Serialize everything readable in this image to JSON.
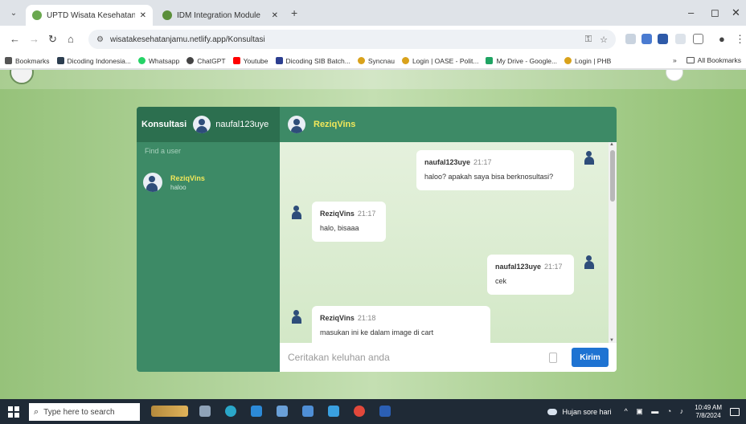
{
  "browser": {
    "tabs": [
      {
        "title": "UPTD Wisata Kesehatan Jamu",
        "active": true,
        "icon": "leaf-favicon-icon"
      },
      {
        "title": "IDM Integration Module",
        "active": false,
        "icon": "leaf-favicon-icon"
      }
    ],
    "url": "wisatakesehatanjamu.netlify.app/Konsultasi",
    "bookmarks": [
      {
        "label": "Bookmarks",
        "color": "#555555"
      },
      {
        "label": "Dicoding Indonesia...",
        "color": "#2c3e50"
      },
      {
        "label": "Whatsapp",
        "color": "#25d366"
      },
      {
        "label": "ChatGPT",
        "color": "#444444"
      },
      {
        "label": "Youtube",
        "color": "#ff0000"
      },
      {
        "label": "Dicoding SIB Batch...",
        "color": "#2c3e90"
      },
      {
        "label": "Syncnau",
        "color": "#d9a21b"
      },
      {
        "label": "Login | OASE - Polit...",
        "color": "#d9a21b"
      },
      {
        "label": "My Drive - Google...",
        "color": "#1fa463"
      },
      {
        "label": "Login | PHB",
        "color": "#d9a21b"
      }
    ],
    "all_bookmarks": "All Bookmarks",
    "more_bookmarks": "»"
  },
  "sidebar": {
    "title": "Konsultasi",
    "username": "naufal123uye",
    "search_placeholder": "Find a user",
    "contacts": [
      {
        "name": "ReziqVins",
        "preview": "haloo"
      }
    ]
  },
  "chat": {
    "contact_name": "ReziqVins",
    "messages": [
      {
        "sender": "naufal123uye",
        "time": "21:17",
        "text": "haloo? apakah saya bisa berknosultasi?",
        "side": "right"
      },
      {
        "sender": "ReziqVins",
        "time": "21:17",
        "text": "halo, bisaaa",
        "side": "left"
      },
      {
        "sender": "naufal123uye",
        "time": "21:17",
        "text": "cek",
        "side": "right"
      },
      {
        "sender": "ReziqVins",
        "time": "21:18",
        "text": "masukan ini ke dalam image di cart",
        "side": "left"
      }
    ],
    "input_placeholder": "Ceritakan keluhan anda",
    "send_label": "Kirim"
  },
  "taskbar": {
    "search_placeholder": "Type here to search",
    "weather": "Hujan sore hari",
    "time": "10:49 AM",
    "date": "7/8/2024"
  },
  "colors": {
    "sidebar": "#3d8a66",
    "header": "#2c6f4f",
    "accent_name": "#f2e85a",
    "send_button": "#1e73d2"
  }
}
